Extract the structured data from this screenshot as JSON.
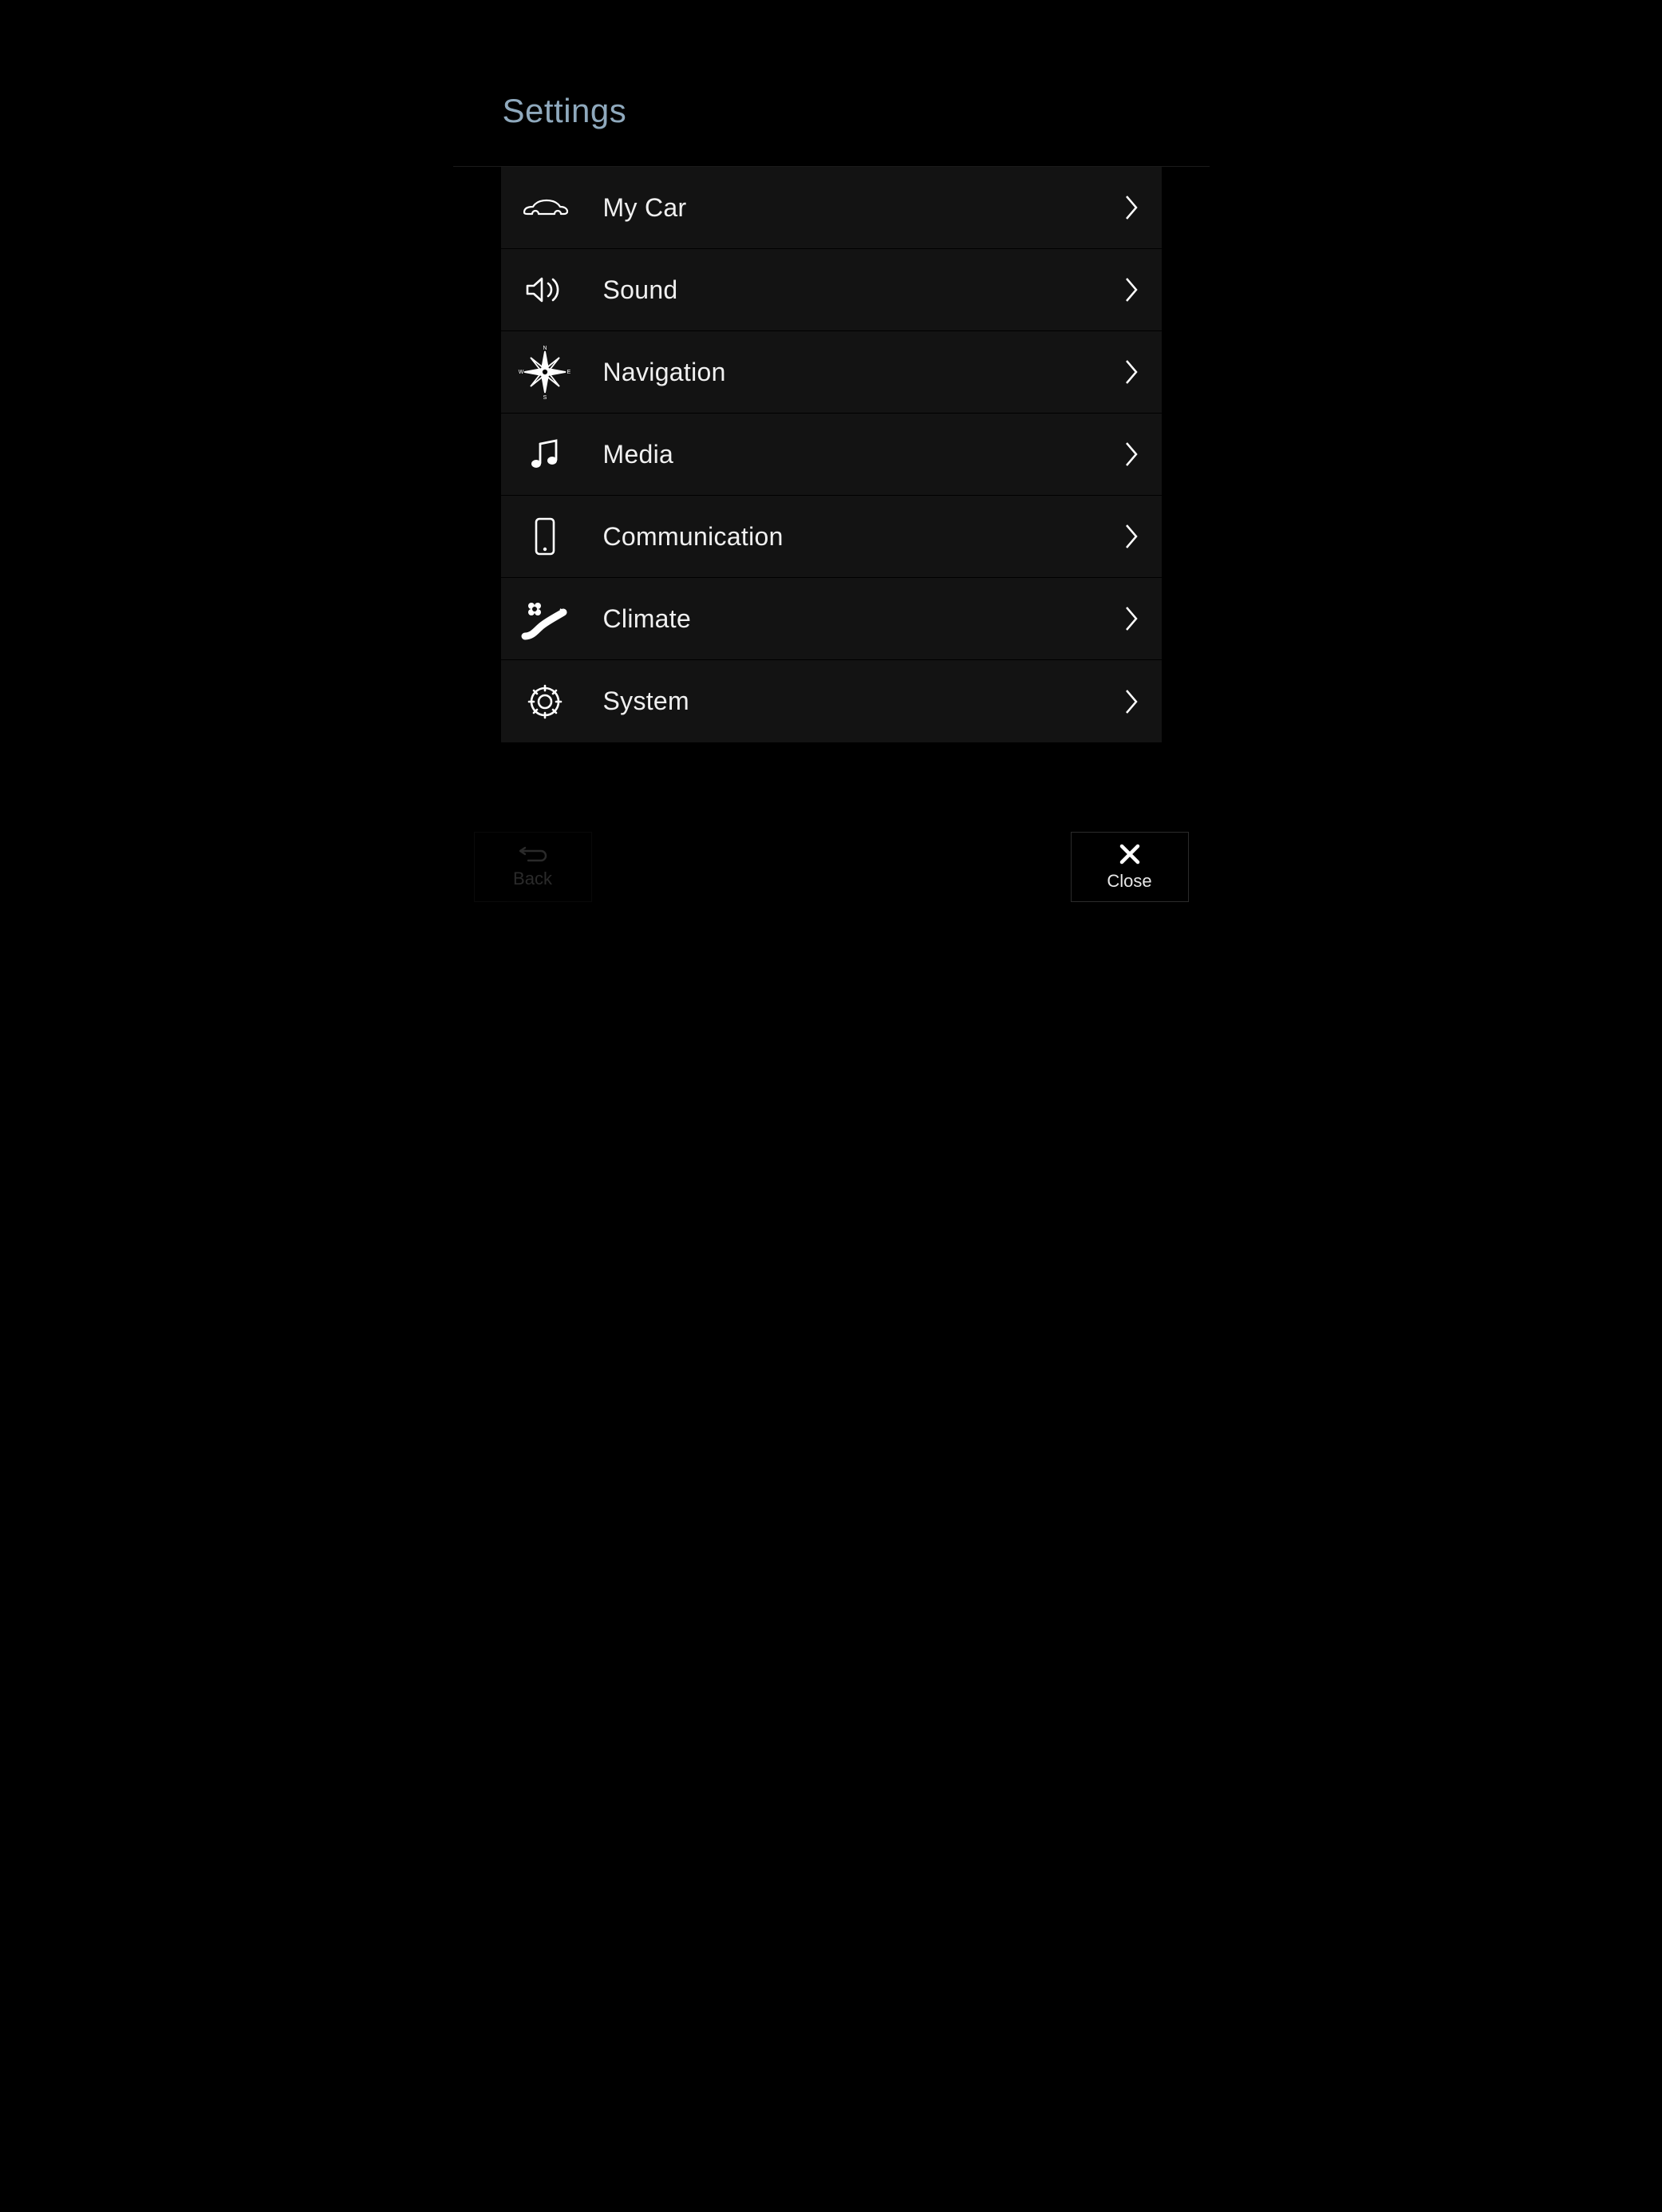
{
  "header": {
    "title": "Settings"
  },
  "menu": {
    "items": [
      {
        "label": "My Car",
        "icon": "car-icon"
      },
      {
        "label": "Sound",
        "icon": "sound-icon"
      },
      {
        "label": "Navigation",
        "icon": "compass-icon"
      },
      {
        "label": "Media",
        "icon": "music-icon"
      },
      {
        "label": "Communication",
        "icon": "phone-icon"
      },
      {
        "label": "Climate",
        "icon": "climate-icon"
      },
      {
        "label": "System",
        "icon": "gear-icon"
      }
    ]
  },
  "footer": {
    "back": {
      "label": "Back",
      "enabled": false
    },
    "close": {
      "label": "Close",
      "enabled": true
    }
  }
}
